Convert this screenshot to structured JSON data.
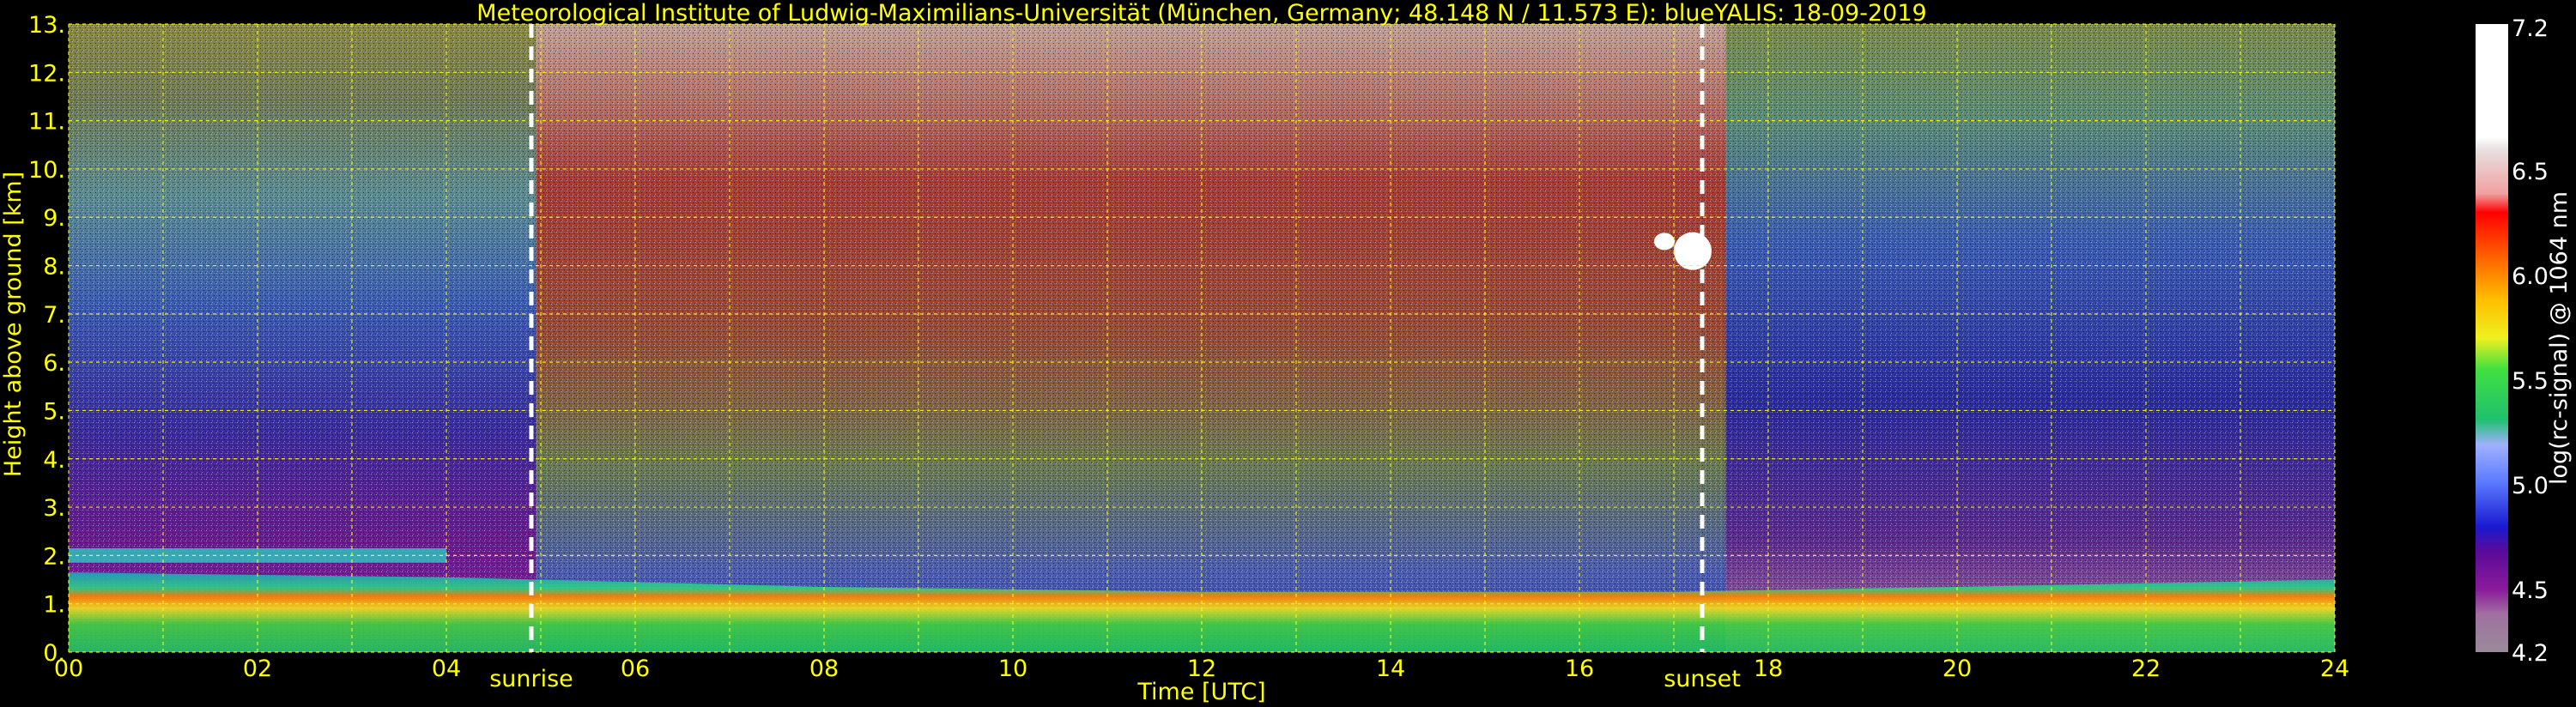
{
  "chart_data": {
    "type": "heatmap",
    "title": "Meteorological Institute of Ludwig-Maximilians-Universität (München, Germany; 48.148 N / 11.573 E):    blueYALIS: 18-09-2019",
    "xlabel": "Time [UTC]",
    "ylabel": "Height above ground [km]",
    "xlim": [
      0,
      24
    ],
    "ylim": [
      0,
      13
    ],
    "x_ticks": [
      "00",
      "02",
      "04",
      "06",
      "08",
      "10",
      "12",
      "14",
      "16",
      "18",
      "20",
      "22",
      "24"
    ],
    "y_ticks": [
      "0.",
      "1.",
      "2.",
      "3.",
      "4.",
      "5.",
      "6.",
      "7.",
      "8.",
      "9.",
      "10.",
      "11.",
      "12.",
      "13."
    ],
    "grid": true,
    "annotations": [
      {
        "text": "sunrise",
        "x": 4.9
      },
      {
        "text": "sunset",
        "x": 17.3
      }
    ],
    "colorbar": {
      "label": "log(rc-signal) @ 1064 nm",
      "range": [
        4.2,
        7.2
      ],
      "ticks": [
        "4.2",
        "4.5",
        "5.0",
        "5.5",
        "6.0",
        "6.5",
        "7.2"
      ]
    },
    "colors": {
      "text": "#ffff00",
      "grid": "#ffff00",
      "background": "#000000",
      "colorbar_label": "#ffffff"
    }
  }
}
